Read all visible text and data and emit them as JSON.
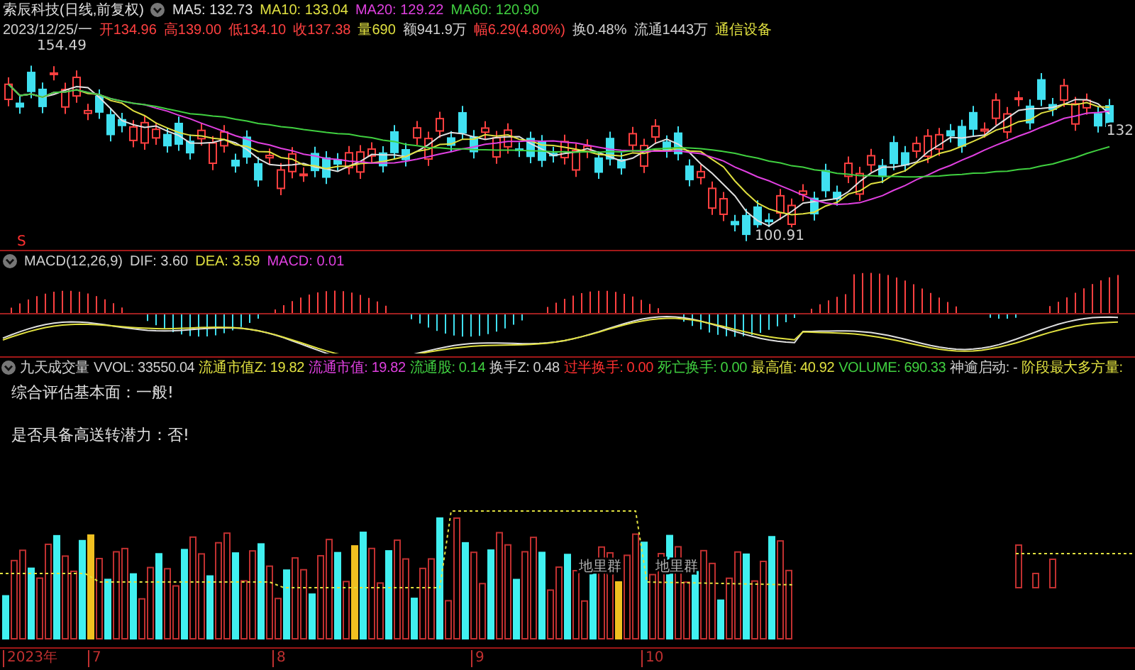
{
  "quote_header": {
    "title": "索辰科技(日线,前复权)",
    "ma_values": [
      {
        "label": "MA5: 132.73",
        "color": "#e0e0e0"
      },
      {
        "label": "MA10: 133.04",
        "color": "#e0e040"
      },
      {
        "label": "MA20: 129.22",
        "color": "#e040e0"
      },
      {
        "label": "MA60: 120.90",
        "color": "#40d040"
      }
    ]
  },
  "quote_details": [
    {
      "text": "2023/12/25/一",
      "color": "#d0d0d0"
    },
    {
      "text": "开134.96",
      "color": "#ff4040"
    },
    {
      "text": "高139.00",
      "color": "#ff4040"
    },
    {
      "text": "低134.10",
      "color": "#ff4040"
    },
    {
      "text": "收137.38",
      "color": "#ff4040"
    },
    {
      "text": "量690",
      "color": "#e0e040"
    },
    {
      "text": "额941.9万",
      "color": "#d0d0d0"
    },
    {
      "text": "幅6.29(4.80%)",
      "color": "#ff4040"
    },
    {
      "text": "换0.48%",
      "color": "#d0d0d0"
    },
    {
      "text": "流通1443万",
      "color": "#d0d0d0"
    },
    {
      "text": "通信设备",
      "color": "#e0e040"
    }
  ],
  "price_chart": {
    "high_label": "154.49",
    "low_label": "100.91",
    "right_label": "132",
    "signal_mark": "S"
  },
  "macd_header": [
    {
      "text": "MACD(12,26,9)",
      "color": "#d0d0d0"
    },
    {
      "text": "DIF: 3.60",
      "color": "#d0d0d0"
    },
    {
      "text": "DEA: 3.59",
      "color": "#e0e040"
    },
    {
      "text": "MACD: 0.01",
      "color": "#e040e0"
    }
  ],
  "volume_header": [
    {
      "text": "九天成交量",
      "color": "#d0d0d0"
    },
    {
      "text": "VVOL: 33550.04",
      "color": "#d0d0d0"
    },
    {
      "text": "流通市值Z: 19.82",
      "color": "#e0e040"
    },
    {
      "text": "流通市值: 19.82",
      "color": "#e040e0"
    },
    {
      "text": "流通股: 0.14",
      "color": "#40d040"
    },
    {
      "text": "换手Z: 0.48",
      "color": "#d0d0d0"
    },
    {
      "text": "过半换手: 0.00",
      "color": "#ff3030"
    },
    {
      "text": "死亡换手: 0.00",
      "color": "#40d040"
    },
    {
      "text": "最高值: 40.92",
      "color": "#e0e040"
    },
    {
      "text": "VOLUME: 690.33",
      "color": "#40d040"
    },
    {
      "text": "神逾启动: -",
      "color": "#d0d0d0"
    },
    {
      "text": "阶段最大多方量:",
      "color": "#e0e040"
    }
  ],
  "assessment": [
    "综合评估基本面：一般!",
    "是否具备高送转潜力：否!"
  ],
  "volume_chart": {
    "labels": [
      "地里群",
      "地里群"
    ]
  },
  "time_axis": [
    "2023年",
    "7",
    "8",
    "9",
    "10"
  ]
}
